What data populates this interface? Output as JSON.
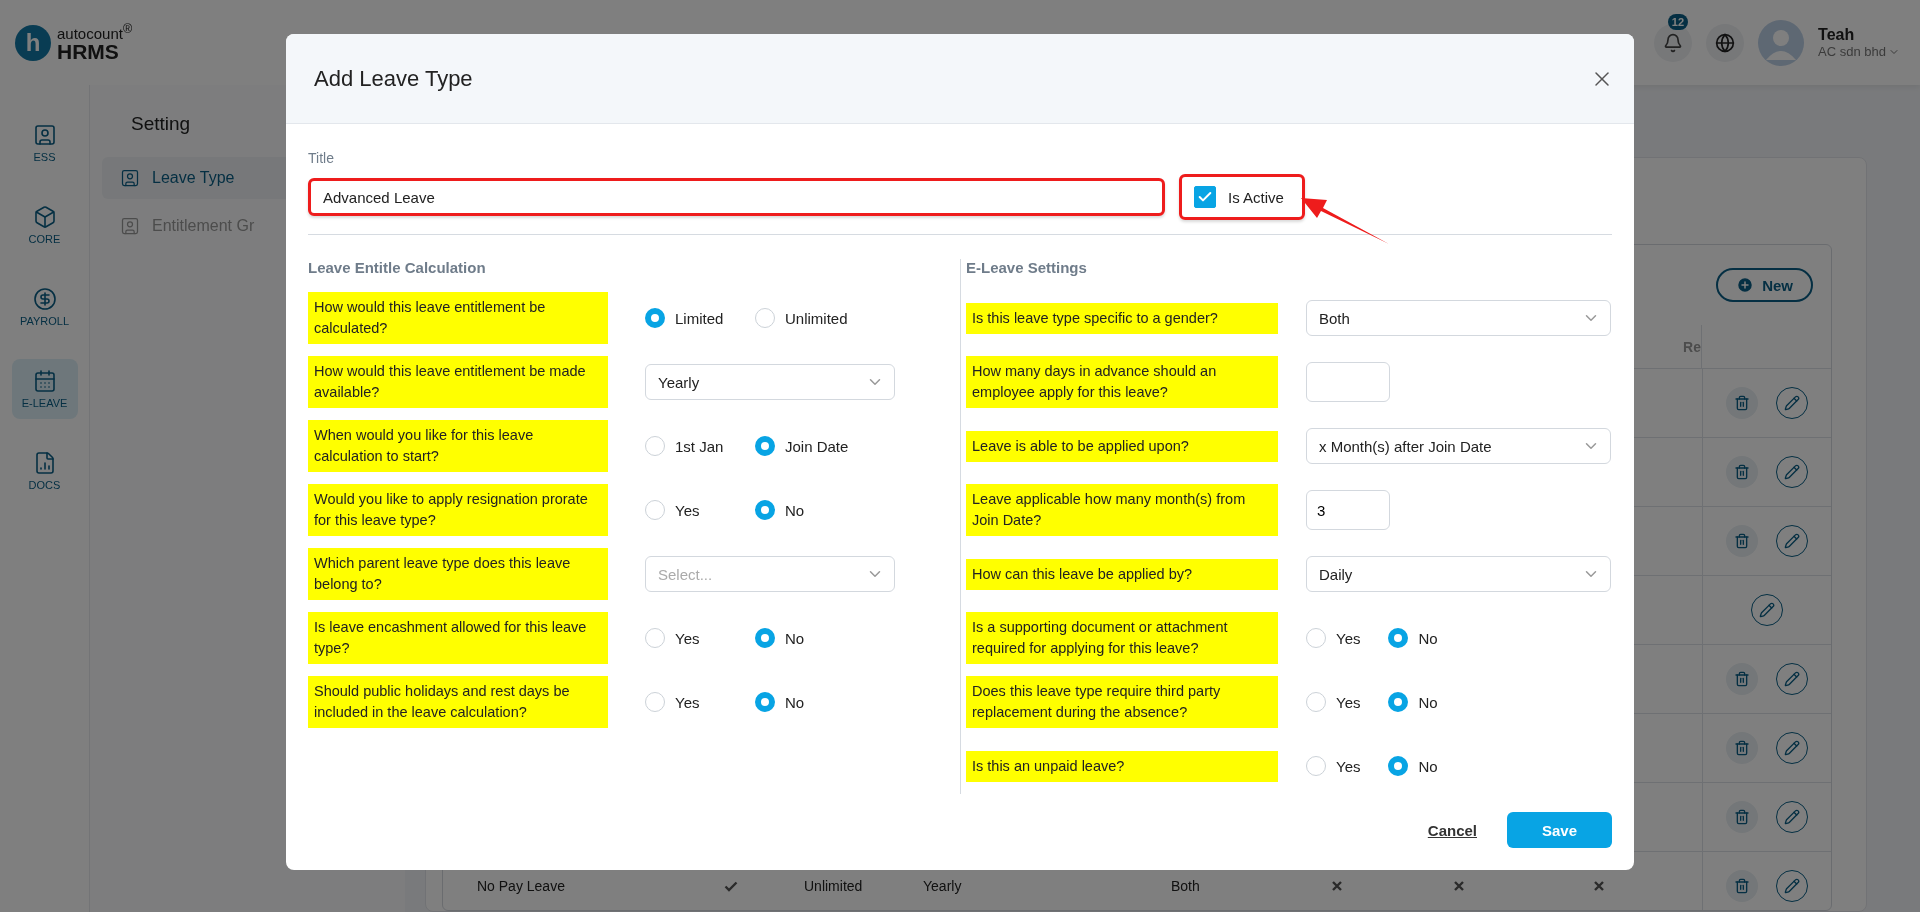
{
  "header": {
    "logo": {
      "mark": "h",
      "brand": "autocount$^{®}$",
      "product": "HRMS"
    },
    "notifications": "12",
    "user": {
      "name": "Teah",
      "company": "AC sdn bhd"
    }
  },
  "rail": [
    {
      "label": "ESS",
      "selected": false
    },
    {
      "label": "CORE",
      "selected": false
    },
    {
      "label": "PAYROLL",
      "selected": false
    },
    {
      "label": "E-LEAVE",
      "selected": true
    },
    {
      "label": "DOCS",
      "selected": false
    }
  ],
  "setting": {
    "title": "Setting",
    "items": [
      {
        "label": "Leave Type",
        "selected": true
      },
      {
        "label": "Entitlement Gr",
        "selected": false
      }
    ]
  },
  "table": {
    "new_button": "New",
    "header_partial": "Re",
    "rows": [
      {
        "actions": [
          {
            "kind": "delete"
          },
          {
            "kind": "edit"
          }
        ],
        "cells": []
      },
      {
        "actions": [
          {
            "kind": "delete"
          },
          {
            "kind": "edit"
          }
        ],
        "cells": []
      },
      {
        "actions": [
          {
            "kind": "delete"
          },
          {
            "kind": "edit"
          }
        ],
        "cells": []
      },
      {
        "actions": [
          {
            "kind": "edit"
          }
        ],
        "cells": []
      },
      {
        "actions": [
          {
            "kind": "delete"
          },
          {
            "kind": "edit"
          }
        ],
        "cells": []
      },
      {
        "actions": [
          {
            "kind": "delete"
          },
          {
            "kind": "edit"
          }
        ],
        "cells": []
      },
      {
        "actions": [
          {
            "kind": "delete"
          },
          {
            "kind": "edit"
          }
        ],
        "cells": []
      },
      {
        "actions": [
          {
            "kind": "delete"
          },
          {
            "kind": "edit"
          }
        ],
        "cells": [
          {
            "kind": "text",
            "text": "No Pay Leave"
          },
          {
            "kind": "check"
          },
          {
            "kind": "text",
            "text": "Unlimited"
          },
          {
            "kind": "text",
            "text": "Yearly"
          },
          {
            "kind": "text",
            "text": "Both"
          },
          {
            "kind": "cross"
          },
          {
            "kind": "cross"
          },
          {
            "kind": "cross"
          }
        ]
      }
    ]
  },
  "dialog": {
    "title": "Add Leave Type",
    "title_label": "Title",
    "title_value": "Advanced Leave",
    "active": {
      "label": "Is Active",
      "checked": true
    },
    "left": {
      "heading": "Leave Entitle Calculation",
      "rows": [
        {
          "question": "How would this leave entitlement be calculated?",
          "kind": "radio",
          "options": [
            {
              "label": "Limited",
              "selected": true
            },
            {
              "label": "Unlimited",
              "selected": false
            }
          ]
        },
        {
          "question": "How would this leave entitlement be made available?",
          "kind": "select",
          "value": "Yearly"
        },
        {
          "question": "When would you like for this leave calculation to start?",
          "kind": "radio",
          "options": [
            {
              "label": "1st Jan",
              "selected": false
            },
            {
              "label": "Join Date",
              "selected": true
            }
          ]
        },
        {
          "question": "Would you like to apply resignation prorate for this leave type?",
          "kind": "radio",
          "options": [
            {
              "label": "Yes",
              "selected": false
            },
            {
              "label": "No",
              "selected": true
            }
          ]
        },
        {
          "question": "Which parent leave type does this leave belong to?",
          "kind": "select",
          "placeholder": "Select..."
        },
        {
          "question": "Is leave encashment allowed for this leave type?",
          "kind": "radio",
          "options": [
            {
              "label": "Yes",
              "selected": false
            },
            {
              "label": "No",
              "selected": true
            }
          ]
        },
        {
          "question": "Should public holidays and rest days be included in the leave calculation?",
          "kind": "radio",
          "options": [
            {
              "label": "Yes",
              "selected": false
            },
            {
              "label": "No",
              "selected": true
            }
          ]
        }
      ]
    },
    "right": {
      "heading": "E-Leave Settings",
      "rows": [
        {
          "question": "Is this leave type specific to a gender?",
          "kind": "select",
          "value": "Both"
        },
        {
          "question": "How many days in advance should an employee apply for this leave?",
          "kind": "input"
        },
        {
          "question": "Leave is able to be applied upon?",
          "kind": "select",
          "value": "x Month(s) after Join Date"
        },
        {
          "question": "Leave applicable how many month(s) from Join Date?",
          "kind": "input",
          "value": "3"
        },
        {
          "question": "How can this leave be applied by?",
          "kind": "select",
          "value": "Daily"
        },
        {
          "question": "Is a supporting document or attachment required for applying for this leave?",
          "kind": "radio",
          "options": [
            {
              "label": "Yes",
              "selected": false
            },
            {
              "label": "No",
              "selected": true
            }
          ]
        },
        {
          "question": "Does this leave type require third party replacement during the absence?",
          "kind": "radio",
          "options": [
            {
              "label": "Yes",
              "selected": false
            },
            {
              "label": "No",
              "selected": true
            }
          ]
        },
        {
          "question": "Is this an unpaid leave?",
          "kind": "radio",
          "options": [
            {
              "label": "Yes",
              "selected": false
            },
            {
              "label": "No",
              "selected": true
            }
          ]
        }
      ]
    },
    "cancel": "Cancel",
    "save": "Save"
  }
}
